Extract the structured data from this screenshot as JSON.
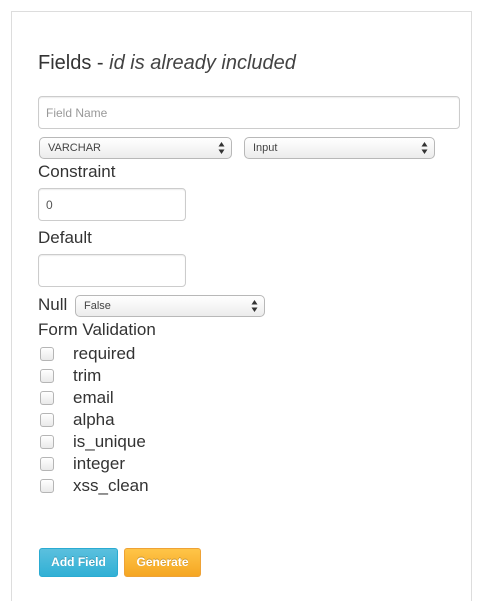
{
  "heading": {
    "title": "Fields - ",
    "note": "id is already included"
  },
  "form": {
    "field_name_placeholder": "Field Name",
    "type_select": "VARCHAR",
    "input_select": "Input",
    "constraint_label": "Constraint",
    "constraint_value": "0",
    "default_label": "Default",
    "default_value": "",
    "null_label": "Null",
    "null_select": "False",
    "validation_label": "Form Validation",
    "validations": [
      {
        "label": "required",
        "checked": false
      },
      {
        "label": "trim",
        "checked": false
      },
      {
        "label": "email",
        "checked": false
      },
      {
        "label": "alpha",
        "checked": false
      },
      {
        "label": "is_unique",
        "checked": false
      },
      {
        "label": "integer",
        "checked": false
      },
      {
        "label": "xss_clean",
        "checked": false
      }
    ]
  },
  "buttons": {
    "add_field": "Add Field",
    "generate": "Generate"
  },
  "colors": {
    "add_field": "#5bc0de",
    "generate": "#f5a623",
    "border": "#dddddd"
  },
  "icons": {
    "select_arrows": "updown-arrows-icon"
  }
}
